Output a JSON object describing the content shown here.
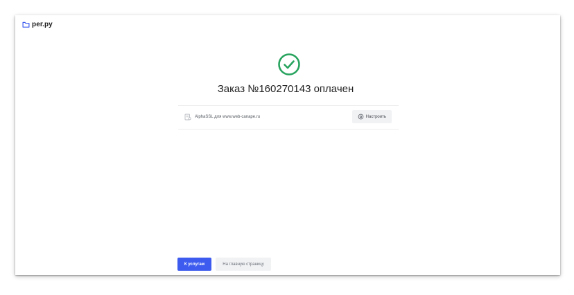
{
  "header": {
    "logo_text": "рег.ру",
    "logo_icon": "folder-icon"
  },
  "status": {
    "icon": "check-circle-icon",
    "title": "Заказ №160270143 оплачен"
  },
  "services": [
    {
      "icon": "certificate-icon",
      "name": "AlphaSSL для www.web-canape.ru",
      "configure_label": "Настроить",
      "configure_icon": "gear-icon"
    }
  ],
  "actions": {
    "primary_label": "К услугам",
    "secondary_label": "На главную страницу"
  },
  "colors": {
    "primary": "#3d5cef",
    "success": "#27a35e",
    "logo_icon": "#3d5cef",
    "secondary_bg": "#f1f2f4"
  }
}
